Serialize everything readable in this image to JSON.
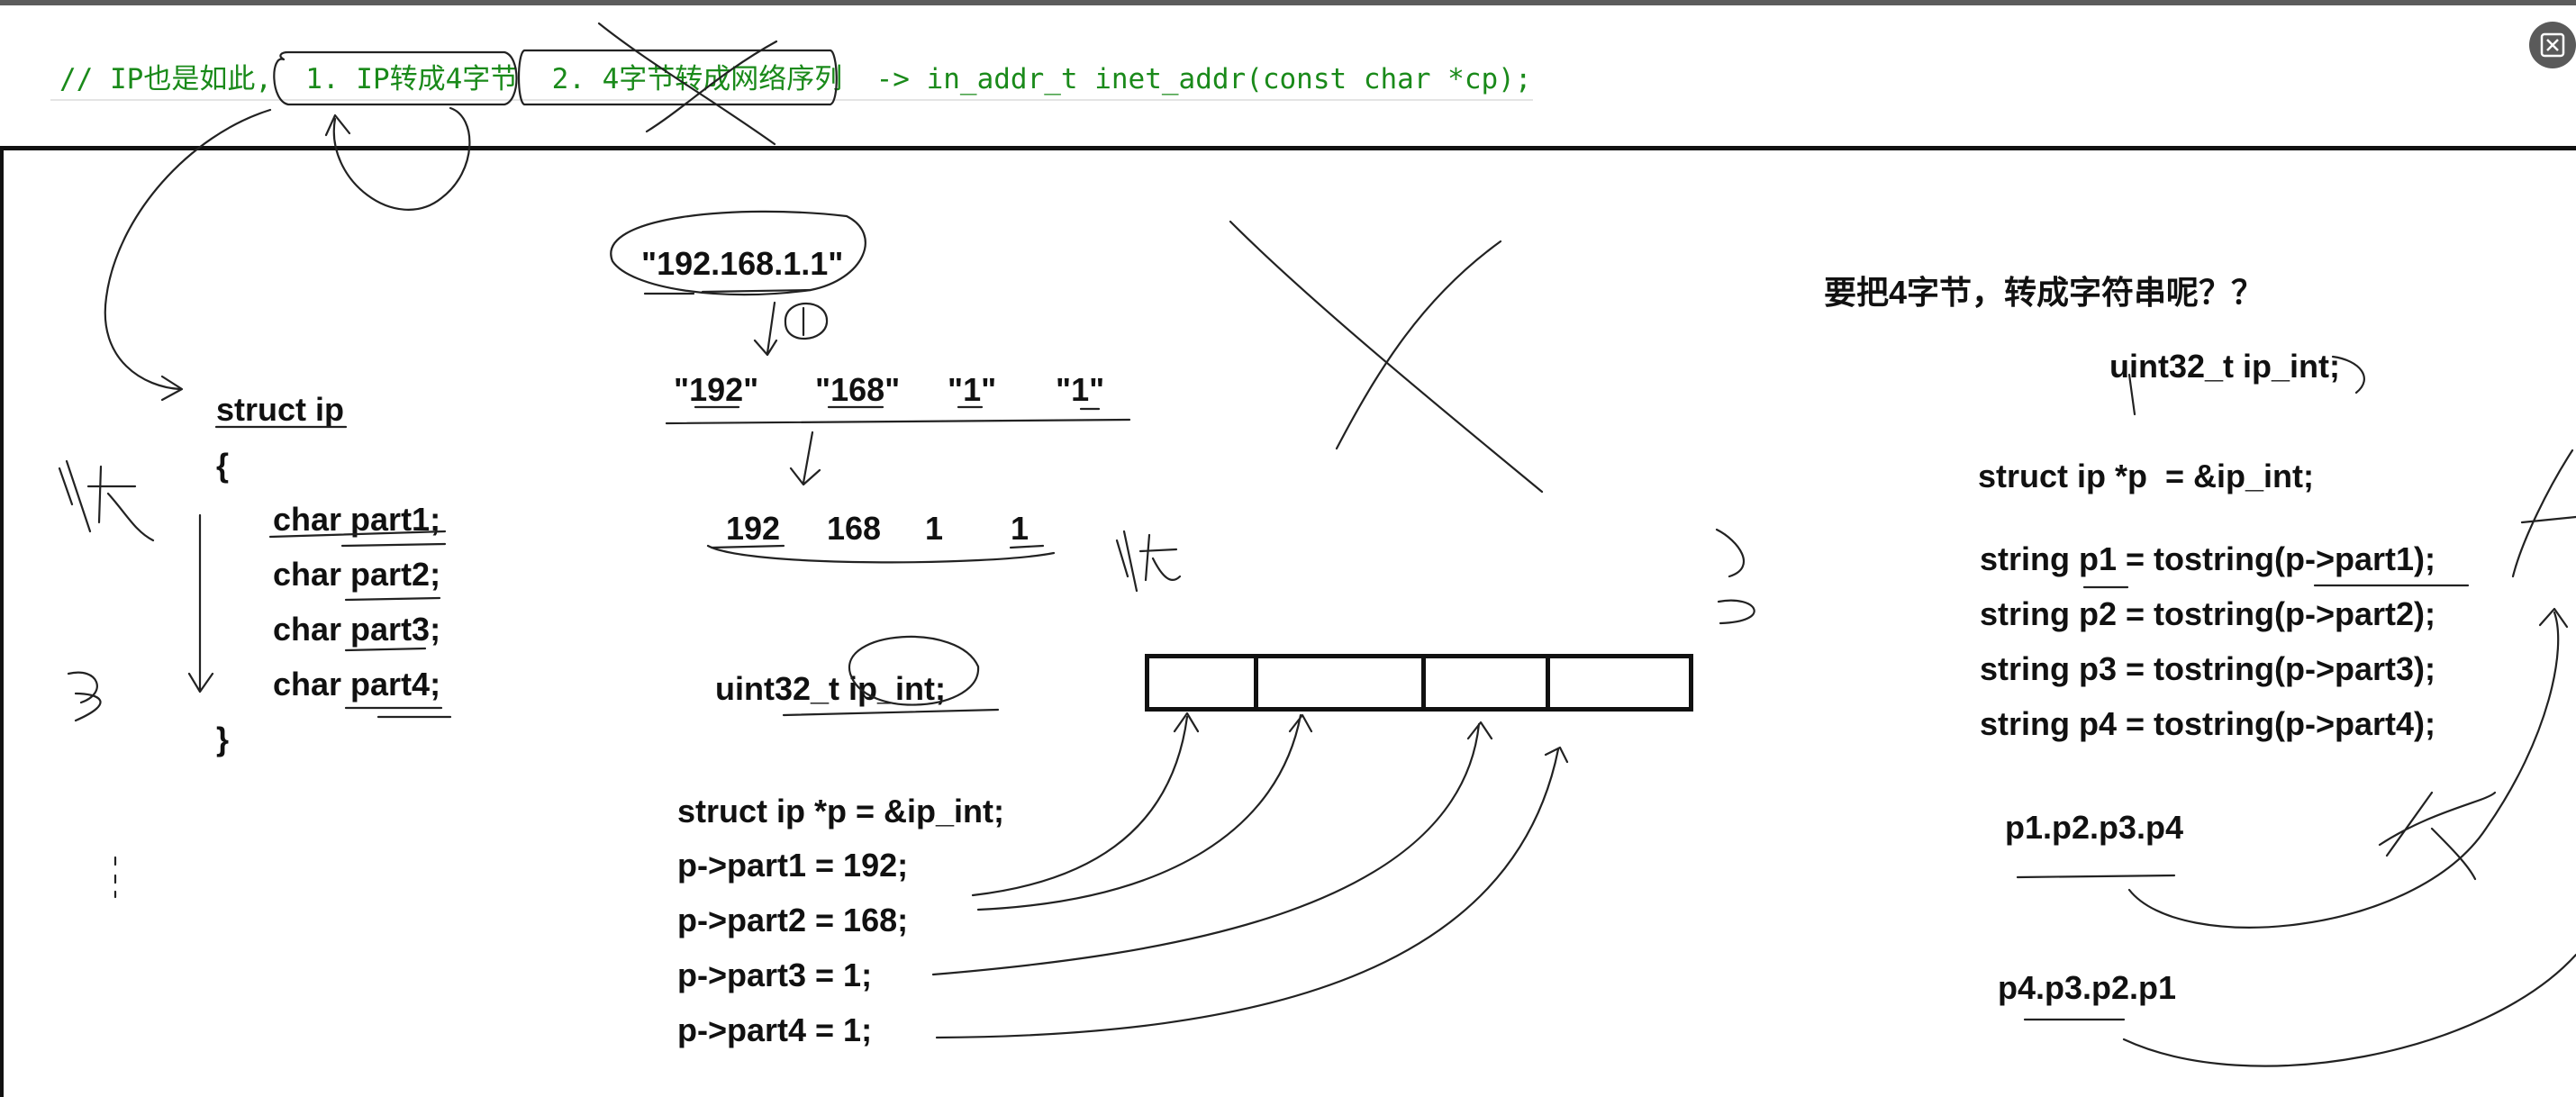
{
  "code_comment": "// IP也是如此,  1. IP转成4字节  2. 4字节转成网络序列  -> in_addr_t inet_addr(const char *cp);",
  "window_controls": {
    "close_icon": "close-icon"
  },
  "whiteboard": {
    "struct_def": {
      "header": "struct ip",
      "open_brace": "{",
      "fields": [
        "char part1;",
        "char part2;",
        "char part3;",
        "char part4;"
      ],
      "close_brace": "}"
    },
    "ip_string": "\"192.168.1.1\"",
    "ip_parts": [
      "\"192\"",
      "\"168\"",
      "\"1\"",
      "\"1\""
    ],
    "ip_numbers": [
      "192",
      "168",
      "1",
      "1"
    ],
    "uint_decl": "uint32_t ip_int;",
    "ptr_decl": "struct ip *p = &ip_int;",
    "assignments": [
      "p->part1 = 192;",
      "p->part2 = 168;",
      "p->part3 = 1;",
      "p->part4 = 1;"
    ],
    "right_question": "要把4字节，转成字符串呢？？",
    "right_uint_decl": "uint32_t ip_int;",
    "right_ptr_decl": "struct ip *p  = &ip_int;",
    "string_lines": [
      "string p1 = tostring(p->part1);",
      "string p2 = tostring(p->part2);",
      "string p3 = tostring(p->part3);",
      "string p4 = tostring(p->part4);"
    ],
    "order_forward": "p1.p2.p3.p4",
    "order_reverse": "p4.p3.p2.p1"
  }
}
